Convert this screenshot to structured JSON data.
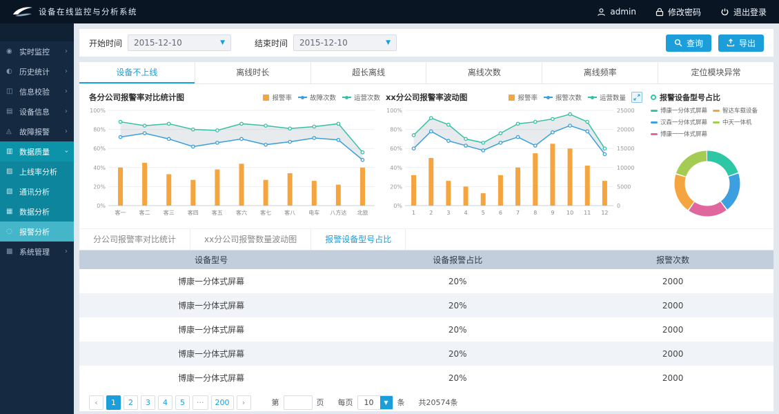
{
  "topbar": {
    "logo_text": "设备在线监控与分析系统",
    "user": "admin",
    "change_password": "修改密码",
    "logout": "退出登录"
  },
  "sidebar": {
    "items": [
      {
        "icon": "◉",
        "label": "实时监控"
      },
      {
        "icon": "◐",
        "label": "历史统计"
      },
      {
        "icon": "◫",
        "label": "信息校验"
      },
      {
        "icon": "▤",
        "label": "设备信息"
      },
      {
        "icon": "◬",
        "label": "故障报警"
      },
      {
        "icon": "▥",
        "label": "数据质量"
      },
      {
        "icon": "▩",
        "label": "系统管理"
      }
    ],
    "submenu": [
      {
        "icon": "▨",
        "label": "上线率分析"
      },
      {
        "icon": "▧",
        "label": "通讯分析"
      },
      {
        "icon": "▦",
        "label": "数据分析"
      },
      {
        "icon": "◌",
        "label": "报警分析"
      }
    ]
  },
  "filters": {
    "start_label": "开始时间",
    "start_value": "2015-12-10",
    "end_label": "结束时间",
    "end_value": "2015-12-10",
    "search_label": "查询",
    "export_label": "导出"
  },
  "tabs": {
    "items": [
      "设备不上线",
      "离线时长",
      "超长离线",
      "离线次数",
      "离线频率",
      "定位模块异常"
    ],
    "active": "设备不上线"
  },
  "chart_data": [
    {
      "type": "bar",
      "title": "各分公司报警率对比统计图",
      "categories": [
        "客一",
        "客二",
        "客三",
        "客四",
        "客五",
        "客六",
        "客七",
        "客八",
        "电车",
        "八方达",
        "北旅"
      ],
      "series": [
        {
          "name": "报警率",
          "type": "bar",
          "color": "#f5a53f",
          "values": [
            40,
            45,
            33,
            27,
            38,
            44,
            27,
            34,
            26,
            22,
            40
          ]
        },
        {
          "name": "故障次数",
          "type": "line",
          "color": "#3a9fd8",
          "values": [
            72,
            76,
            70,
            62,
            66,
            70,
            64,
            67,
            71,
            69,
            48
          ]
        },
        {
          "name": "运营次数",
          "type": "line",
          "color": "#35c0a4",
          "values": [
            88,
            84,
            86,
            80,
            79,
            86,
            84,
            81,
            83,
            86,
            56
          ]
        }
      ],
      "ylim": [
        0,
        100
      ],
      "yticks": [
        "0%",
        "20%",
        "40%",
        "60%",
        "80%",
        "100%"
      ],
      "grid": true,
      "legend_position": "top-right"
    },
    {
      "type": "bar",
      "title": "xx分公司报警率波动图",
      "categories": [
        "1",
        "2",
        "3",
        "4",
        "5",
        "6",
        "7",
        "8",
        "9",
        "10",
        "11",
        "12"
      ],
      "series": [
        {
          "name": "报警率",
          "type": "bar",
          "color": "#f5a53f",
          "values": [
            32,
            50,
            26,
            20,
            13,
            32,
            40,
            55,
            65,
            60,
            42,
            26
          ]
        },
        {
          "name": "报警次数",
          "type": "line",
          "color": "#3a9fd8",
          "values": [
            60,
            78,
            68,
            63,
            58,
            66,
            72,
            63,
            77,
            84,
            78,
            54
          ]
        },
        {
          "name": "运营数量",
          "type": "line",
          "color": "#35c0a4",
          "values": [
            74,
            92,
            85,
            70,
            66,
            76,
            86,
            88,
            91,
            96,
            88,
            60
          ]
        }
      ],
      "ylim": [
        0,
        100
      ],
      "y2lim": [
        0,
        25000
      ],
      "y2ticks": [
        "0",
        "5000",
        "10000",
        "15000",
        "20000",
        "25000"
      ],
      "grid": true,
      "legend_position": "top-right"
    },
    {
      "type": "pie",
      "title": "报警设备型号占比",
      "labels": [
        "博康一分体式屏幕",
        "汉森一分体式屏幕",
        "博康一一体式屏幕",
        "智达车载设备",
        "中天一体机"
      ],
      "values": [
        20,
        20,
        20,
        20,
        20
      ],
      "colors": [
        "#2dc7a5",
        "#3b9fe0",
        "#e0679e",
        "#f5a53f",
        "#a5cc52"
      ],
      "legend_position": "top"
    }
  ],
  "subtabs": {
    "items": [
      "分公司报警率对比统计",
      "xx分公司报警数量波动图",
      "报警设备型号占比"
    ],
    "active": "报警设备型号占比"
  },
  "table": {
    "headers": [
      "设备型号",
      "设备报警占比",
      "报警次数"
    ],
    "rows": [
      [
        "博康一分体式屏幕",
        "20%",
        "2000"
      ],
      [
        "博康一分体式屏幕",
        "20%",
        "2000"
      ],
      [
        "博康一分体式屏幕",
        "20%",
        "2000"
      ],
      [
        "博康一分体式屏幕",
        "20%",
        "2000"
      ],
      [
        "博康一分体式屏幕",
        "20%",
        "2000"
      ]
    ]
  },
  "pagination": {
    "prev": "‹",
    "next": "›",
    "pages": [
      "1",
      "2",
      "3",
      "4",
      "5",
      "···",
      "200"
    ],
    "active": "1",
    "goto_prefix": "第",
    "goto_suffix": "页",
    "per_page_prefix": "每页",
    "per_page_value": "10",
    "per_page_suffix": "条",
    "total": "共20574条"
  },
  "colors": {
    "accent": "#1b9ed9",
    "topbar_bg": "#0a1523",
    "sidebar_bg": "#152a40",
    "menu_active": "#0d93a9",
    "table_header_bg": "#c3cedd"
  }
}
